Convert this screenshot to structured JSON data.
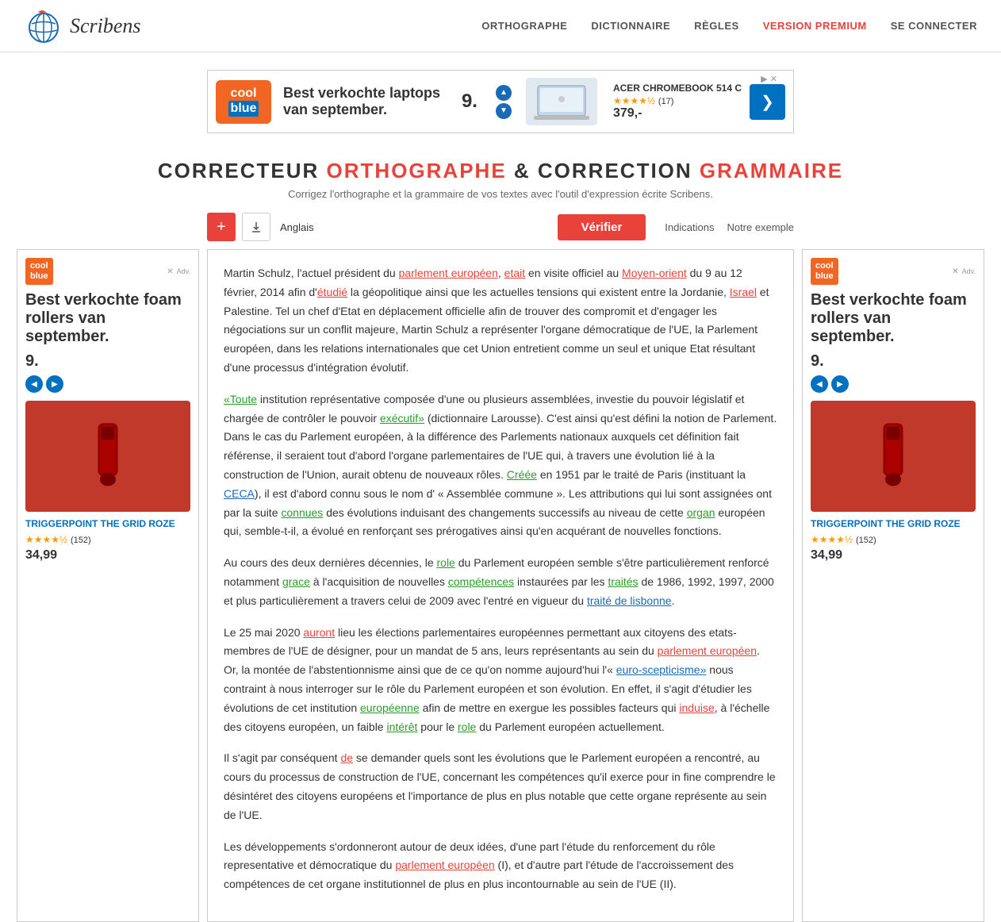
{
  "header": {
    "logo_text": "Scribens",
    "nav": {
      "orthographe": "ORTHOGRAPHE",
      "dictionnaire": "DICTIONNAIRE",
      "regles": "RÈGLES",
      "premium": "VERSION PREMIUM",
      "connect": "SE CONNECTER"
    }
  },
  "ad_banner": {
    "brand": "cool\nblue",
    "tagline": "Best verkochte laptops van september.",
    "rating_num": "9.",
    "product_name": "ACER CHROMEBOOK 514 C",
    "stars": "★★★★½",
    "review_count": "(17)",
    "price": "379,-",
    "close": "▶"
  },
  "main": {
    "title_part1": "CORRECTEUR",
    "title_orange1": "ORTHOGRAPHE",
    "title_part2": "& CORRECTION",
    "title_orange2": "GRAMMAIRE",
    "subtitle": "Corrigez l'orthographe et la grammaire de vos textes avec l'outil d'expression écrite Scribens.",
    "toolbar": {
      "plus_label": "+",
      "download_icon": "⬇",
      "lang": "Anglais",
      "verify_btn": "Vérifier",
      "indications": "Indications",
      "notre_exemple": "Notre exemple"
    }
  },
  "side_ad_left": {
    "brand_line1": "cool",
    "brand_line2": "blue",
    "text": "Best verkochte foam rollers van september.",
    "num": "9.",
    "product_name": "TRIGGERPOINT THE GRID ROZE",
    "stars": "★★★★½",
    "review_count": "(152)",
    "price": "34,99"
  },
  "side_ad_right": {
    "brand_line1": "cool",
    "brand_line2": "blue",
    "text": "Best verkochte foam rollers van september.",
    "num": "9.",
    "product_name": "TRIGGERPOINT THE GRID ROZE",
    "stars": "★★★★½",
    "review_count": "(152)",
    "price": "34,99"
  },
  "article": {
    "p1": "Martin Schulz, l'actuel président du parlement européen, etait en visite officiel au Moyen-orient du 9 au 12 février, 2014 afin d'étudié la géopolitique ainsi que les actuelles tensions qui existent entre la Jordanie, Israel et Palestine. Tel un chef d'Etat en déplacement officielle afin de trouver des compromit et d'engager les négociations sur un conflit majeure, Martin Schulz a représenter l'organe démocratique de l'UE, la Parlement européen, dans les relations internationales que cet Union entretient comme un seul et unique Etat résultant d'une processus d'intégration évolutif.",
    "p2": "«Toute institution représentative composée d'une ou plusieurs assemblées, investie du pouvoir législatif et chargée de contrôler le pouvoir exécutif» (dictionnaire Larousse). C'est ainsi qu'est défini la notion de Parlement. Dans le cas du Parlement européen, à la différence des Parlements nationaux auxquels cet définition fait référense, il seraient tout d'abord l'organe parlementaires de l'UE qui, à travers une évolution lié à la construction de l'Union, aurait obtenu de nouveaux rôles. Créée en 1951 par le traité de Paris (instituant la CECA), il est d'abord connu sous le nom d' « Assemblée commune ». Les attributions qui lui sont assignées ont par la suite connues des évolutions induisant des changements successifs au niveau de cette organ européen qui, semble-t-il, a évolué en renforçant ses prérogatives ainsi qu'en acquérant de nouvelles fonctions.",
    "p3": "Au cours des deux dernières décennies, le role du Parlement européen semble s'être particulièrement renforcé notamment grace à l'acquisition de nouvelles compétences instaurées par les traités de 1986, 1992, 1997, 2000 et plus particulièrement a travers celui de 2009 avec l'entré en vigueur du traité de lisbonne.",
    "p4": "Le 25 mai 2020 auront lieu les élections parlementaires européennes permettant aux citoyens des etats-membres de l'UE de désigner, pour un mandat de 5 ans, leurs représentants au sein du parlement européen. Or, la montée de l'abstentionnisme ainsi que de ce qu'on nomme aujourd'hui l'« euro-scepticisme» nous contraint à nous interroger sur le rôle du Parlement européen et son évolution. En effet, il s'agit d'étudier les évolutions de cet institution européenne afin de mettre en exergue les possibles facteurs qui induise, à l'échelle des citoyens européen, un faible intérêt pour le role du Parlement européen actuellement.",
    "p5": "Il s'agit par conséquent de se demander quels sont les évolutions que le Parlement européen a rencontré, au cours du processus de construction de l'UE, concernant les compétences qu'il exerce pour in fine comprendre le désintéret des citoyens européens et l'importance de plus en plus notable que cette organe représente au sein de l'UE.",
    "p6": "Les développements s'ordonneront autour de deux idées, d'une part l'étude du renforcement du rôle representative et démocratique du parlement européen (I), et d'autre part l'étude de l'accroissement des compétences de cet organe institutionnel de plus en plus incontournable au sein de l'UE (II)."
  }
}
